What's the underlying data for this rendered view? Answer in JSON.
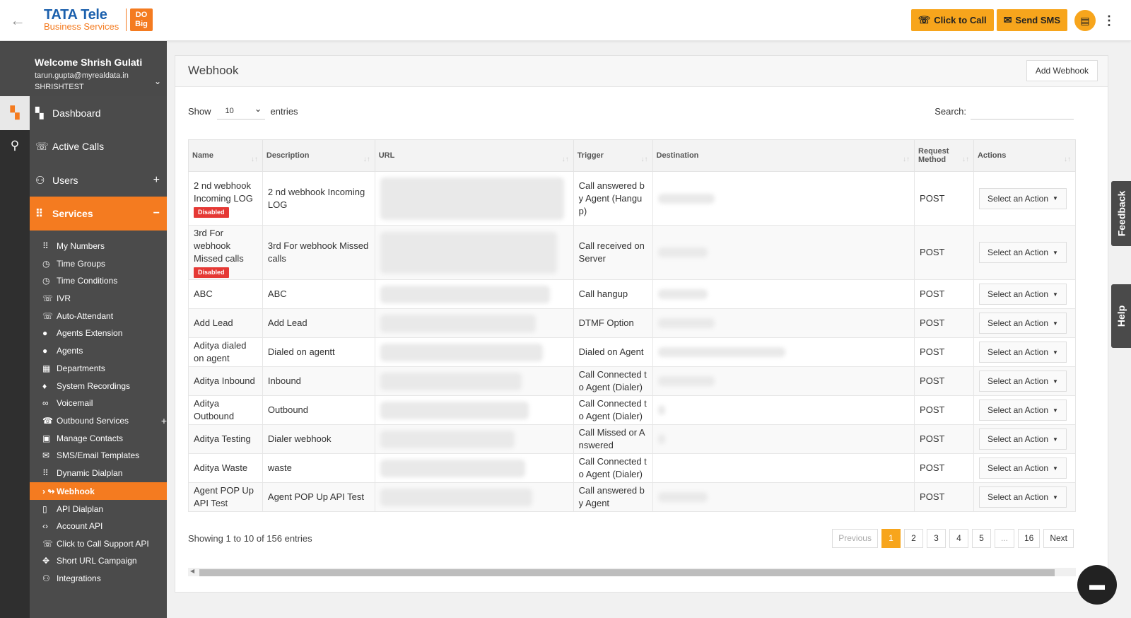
{
  "topbar": {
    "logo_brand": "TATA Tele",
    "logo_sub": "Business Services",
    "logo_badge": "DO Big",
    "click_to_call": "Click to Call",
    "send_sms": "Send SMS"
  },
  "user": {
    "welcome": "Welcome Shrish Gulati",
    "email": "tarun.gupta@myrealdata.in",
    "org": "SHRISHTEST"
  },
  "nav": {
    "dashboard": "Dashboard",
    "active_calls": "Active Calls",
    "users": "Users",
    "services": "Services"
  },
  "subnav": [
    {
      "label": "My Numbers",
      "icon": "grid-icon",
      "glyph": "⠿"
    },
    {
      "label": "Time Groups",
      "icon": "clock-icon",
      "glyph": "◷"
    },
    {
      "label": "Time Conditions",
      "icon": "clock-icon",
      "glyph": "◷"
    },
    {
      "label": "IVR",
      "icon": "phone-icon",
      "glyph": "☏"
    },
    {
      "label": "Auto-Attendant",
      "icon": "phone-icon",
      "glyph": "☏"
    },
    {
      "label": "Agents Extension",
      "icon": "person-icon",
      "glyph": "●"
    },
    {
      "label": "Agents",
      "icon": "person-icon",
      "glyph": "●"
    },
    {
      "label": "Departments",
      "icon": "building-icon",
      "glyph": "▦"
    },
    {
      "label": "System Recordings",
      "icon": "mic-icon",
      "glyph": "♦"
    },
    {
      "label": "Voicemail",
      "icon": "voicemail-icon",
      "glyph": "∞"
    },
    {
      "label": "Outbound Services",
      "icon": "outbound-icon",
      "glyph": "☎"
    },
    {
      "label": "Manage Contacts",
      "icon": "contacts-icon",
      "glyph": "▣"
    },
    {
      "label": "SMS/Email Templates",
      "icon": "mail-icon",
      "glyph": "✉"
    },
    {
      "label": "Dynamic Dialplan",
      "icon": "grid-icon",
      "glyph": "⠿"
    },
    {
      "label": "Webhook",
      "icon": "webhook-icon",
      "glyph": "↬"
    },
    {
      "label": "API Dialplan",
      "icon": "mobile-icon",
      "glyph": "▯"
    },
    {
      "label": "Account API",
      "icon": "code-icon",
      "glyph": "‹›"
    },
    {
      "label": "Click to Call Support API",
      "icon": "phone-icon",
      "glyph": "☏"
    },
    {
      "label": "Short URL Campaign",
      "icon": "link-icon",
      "glyph": "✥"
    },
    {
      "label": "Integrations",
      "icon": "people-icon",
      "glyph": "⚇"
    }
  ],
  "page": {
    "title": "Webhook",
    "add_button": "Add Webhook",
    "show_label": "Show",
    "entries_value": "10",
    "entries_label": "entries",
    "search_label": "Search:",
    "search_value": "",
    "showing_text": "Showing 1 to 10 of 156 entries"
  },
  "table": {
    "headers": [
      "Name",
      "Description",
      "URL",
      "Trigger",
      "Destination",
      "Request Method",
      "Actions"
    ],
    "rows": [
      {
        "name": "2 nd webhook Incoming LOG",
        "disabled": true,
        "description": "2 nd webhook Incoming LOG",
        "trigger": "Call answered by Agent (Hangup)",
        "method": "POST"
      },
      {
        "name": "3rd For webhook Missed calls",
        "disabled": true,
        "description": "3rd For webhook Missed calls",
        "trigger": "Call received on Server",
        "method": "POST"
      },
      {
        "name": "ABC",
        "disabled": false,
        "description": "ABC",
        "trigger": "Call hangup",
        "method": "POST"
      },
      {
        "name": "Add Lead",
        "disabled": false,
        "description": "Add Lead",
        "trigger": "DTMF Option",
        "method": "POST"
      },
      {
        "name": "Aditya dialed on agent",
        "disabled": false,
        "description": "Dialed on agentt",
        "trigger": "Dialed on Agent",
        "method": "POST"
      },
      {
        "name": "Aditya Inbound",
        "disabled": false,
        "description": "Inbound",
        "trigger": "Call Connected to Agent (Dialer)",
        "method": "POST"
      },
      {
        "name": "Aditya Outbound",
        "disabled": false,
        "description": "Outbound",
        "trigger": "Call Connected to Agent (Dialer)",
        "method": "POST"
      },
      {
        "name": "Aditya Testing",
        "disabled": false,
        "description": "Dialer webhook",
        "trigger": "Call Missed or Answered",
        "method": "POST"
      },
      {
        "name": "Aditya Waste",
        "disabled": false,
        "description": "waste",
        "trigger": "Call Connected to Agent (Dialer)",
        "method": "POST"
      },
      {
        "name": "Agent POP Up API Test",
        "disabled": false,
        "description": "Agent POP Up API Test",
        "trigger": "Call answered by Agent",
        "method": "POST"
      }
    ],
    "disabled_label": "Disabled",
    "action_label": "Select an Action"
  },
  "pagination": {
    "previous": "Previous",
    "pages": [
      "1",
      "2",
      "3",
      "4",
      "5",
      "...",
      "16"
    ],
    "active": "1",
    "next": "Next"
  },
  "side_tabs": {
    "feedback": "Feedback",
    "help": "Help"
  },
  "colors": {
    "accent": "#f47b20",
    "button_orange": "#f7a51c",
    "sidebar_bg": "#4b4b4b",
    "badge_red": "#e53935"
  }
}
